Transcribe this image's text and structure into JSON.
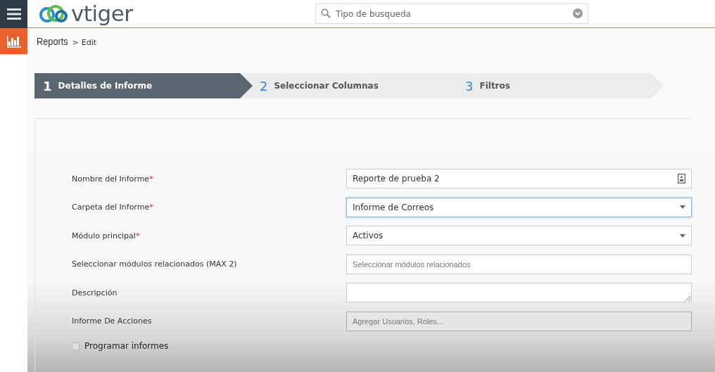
{
  "header": {
    "logo": "vtiger",
    "search": {
      "placeholder": "Tipo de busqueda"
    }
  },
  "breadcrumb": {
    "module": "Reports",
    "separator": ">",
    "page": "Edit"
  },
  "steps": [
    {
      "number": "1",
      "label": "Detalles de Informe",
      "selected": true
    },
    {
      "number": "2",
      "label": "Seleccionar Columnas",
      "selected": false
    },
    {
      "number": "3",
      "label": "Filtros",
      "selected": false
    }
  ],
  "form": {
    "fields": [
      {
        "label": "Nombre del Informe",
        "required_mark": "*",
        "kind": "text",
        "value": "Reporte de prueba 2",
        "focused": false
      },
      {
        "label": "Carpeta del Informe",
        "required_mark": "*",
        "kind": "select",
        "value": "Informe de Correos",
        "focused": true
      },
      {
        "label": "Módulo principal",
        "required_mark": "*",
        "kind": "select",
        "value": "Activos",
        "focused": false
      },
      {
        "label": "Seleccionar módulos relacionados (MAX 2)",
        "kind": "multiselect",
        "placeholder": "Seleccionar módulos relacionados",
        "focused": false
      },
      {
        "label": "Descripción",
        "kind": "textarea",
        "focused": false
      },
      {
        "label": "Informe De Acciones",
        "kind": "tags",
        "placeholder": "Agregar Usuarios, Roles...",
        "focused": false
      }
    ],
    "schedule": {
      "label": "Programar informes",
      "checked": false
    }
  }
}
